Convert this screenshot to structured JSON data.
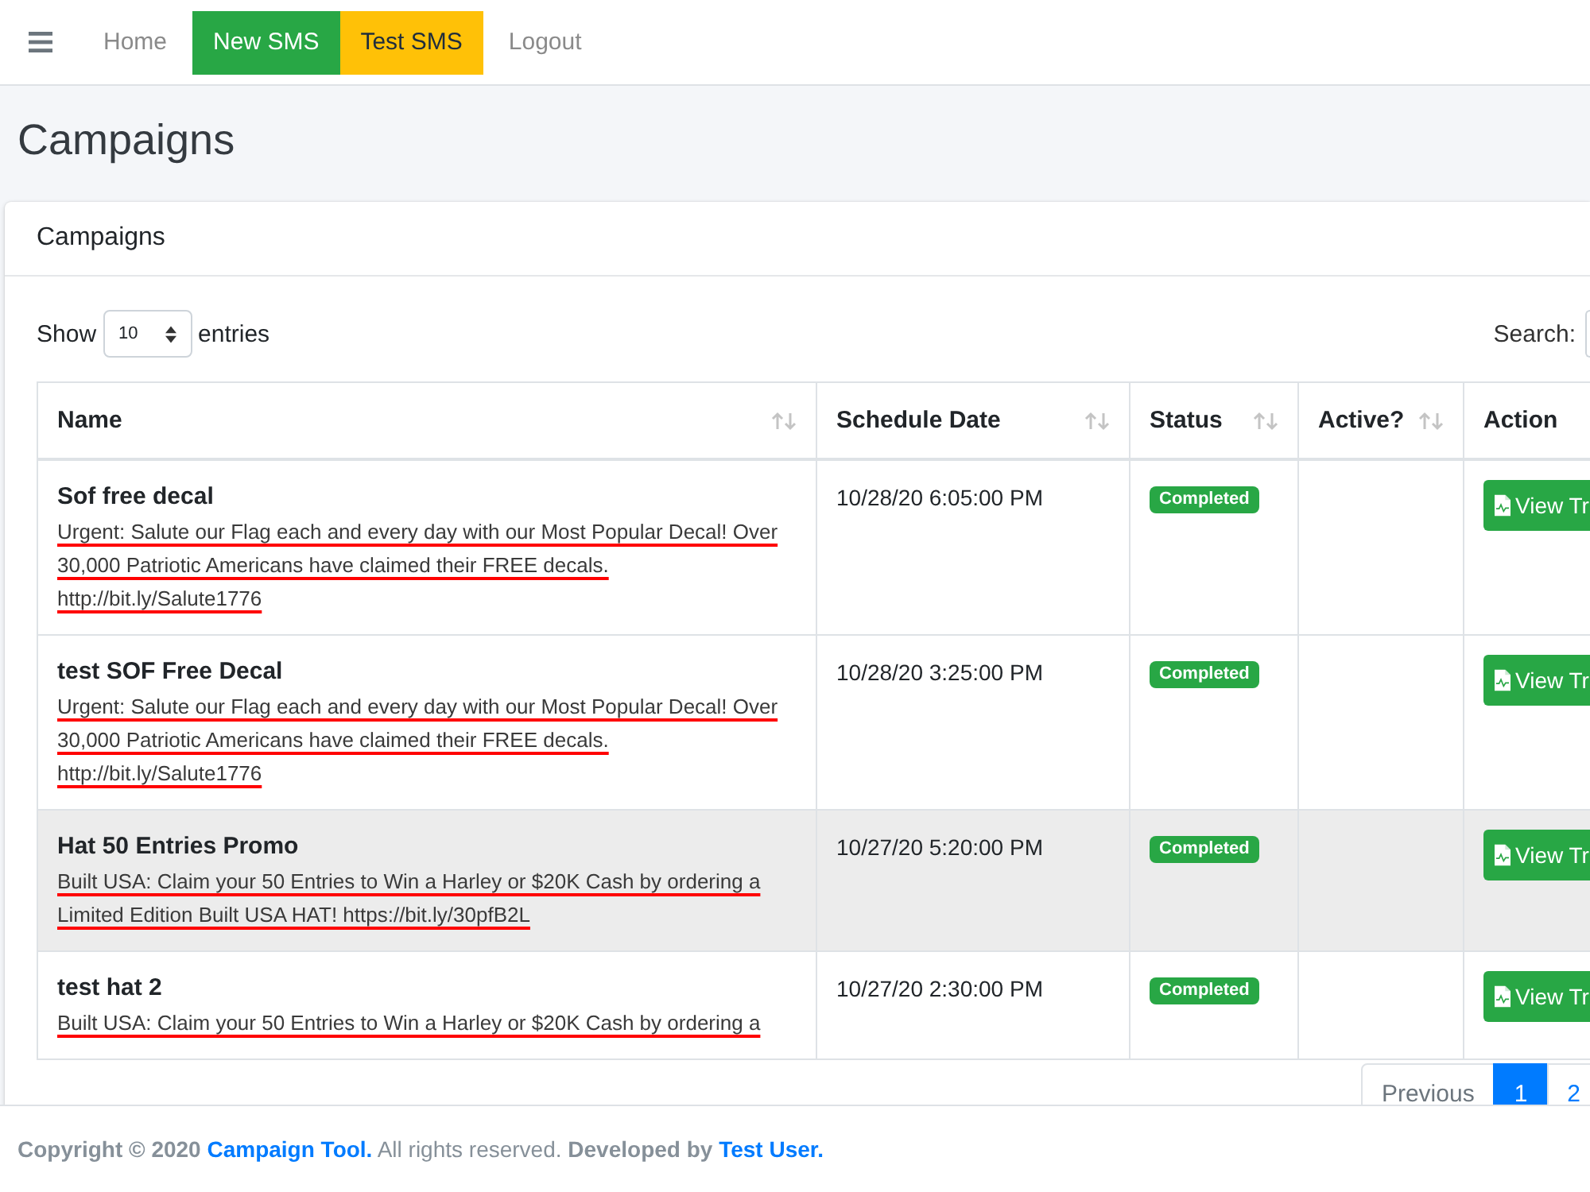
{
  "navbar": {
    "items": [
      {
        "label": "Home",
        "kind": "link"
      },
      {
        "label": "New SMS",
        "kind": "success"
      },
      {
        "label": "Test SMS",
        "kind": "warning"
      },
      {
        "label": "Logout",
        "kind": "link"
      }
    ]
  },
  "page_title": "Campaigns",
  "card": {
    "title": "Campaigns",
    "length_menu": {
      "before": "Show",
      "value": "10",
      "after": "entries"
    },
    "search": {
      "label": "Search:"
    },
    "table": {
      "columns": [
        {
          "label": "Name",
          "sortable": true
        },
        {
          "label": "Schedule Date",
          "sortable": true
        },
        {
          "label": "Status",
          "sortable": true
        },
        {
          "label": "Active?",
          "sortable": true
        },
        {
          "label": "Action",
          "sortable": false
        }
      ],
      "rows": [
        {
          "name": "Sof free decal",
          "message": "Urgent: Salute our Flag each and every day with our Most Popular Decal! Over 30,000 Patriotic Americans have claimed their FREE decals.\nhttp://bit.ly/Salute1776",
          "redacted": true,
          "schedule_date": "10/28/20 6:05:00 PM",
          "status": {
            "label": "Completed",
            "kind": "success"
          },
          "action": "View Tr",
          "highlighted": false
        },
        {
          "name": "test SOF Free Decal",
          "message": "Urgent: Salute our Flag each and every day with our Most Popular Decal! Over 30,000 Patriotic Americans have claimed their FREE decals.\nhttp://bit.ly/Salute1776",
          "redacted": true,
          "schedule_date": "10/28/20 3:25:00 PM",
          "status": {
            "label": "Completed",
            "kind": "success"
          },
          "action": "View Tr",
          "highlighted": false
        },
        {
          "name": "Hat 50 Entries Promo",
          "message": "Built USA: Claim your 50 Entries to Win a Harley or $20K Cash by ordering a Limited Edition Built USA HAT! https://bit.ly/30pfB2L",
          "redacted": true,
          "schedule_date": "10/27/20 5:20:00 PM",
          "status": {
            "label": "Completed",
            "kind": "success"
          },
          "action": "View Tr",
          "highlighted": true
        },
        {
          "name": "test hat 2",
          "message": "Built USA: Claim your 50 Entries to Win a Harley or $20K Cash by ordering a",
          "redacted": true,
          "schedule_date": "10/27/20 2:30:00 PM",
          "status": {
            "label": "Completed",
            "kind": "success"
          },
          "action": "View Tr",
          "highlighted": false
        }
      ]
    },
    "pagination": {
      "previous": {
        "label": "Previous",
        "disabled": true
      },
      "pages": [
        {
          "label": "1",
          "selected": true
        },
        {
          "label": "2",
          "selected": false
        }
      ]
    }
  },
  "footer": {
    "segments": [
      {
        "text": "Copyright © 2020",
        "kind": "bold"
      },
      {
        "text": "Campaign Tool.",
        "kind": "link"
      },
      {
        "text": "All rights reserved.",
        "kind": "plain"
      },
      {
        "text": "Developed by",
        "kind": "bold"
      },
      {
        "text": "Test User.",
        "kind": "link"
      }
    ]
  }
}
